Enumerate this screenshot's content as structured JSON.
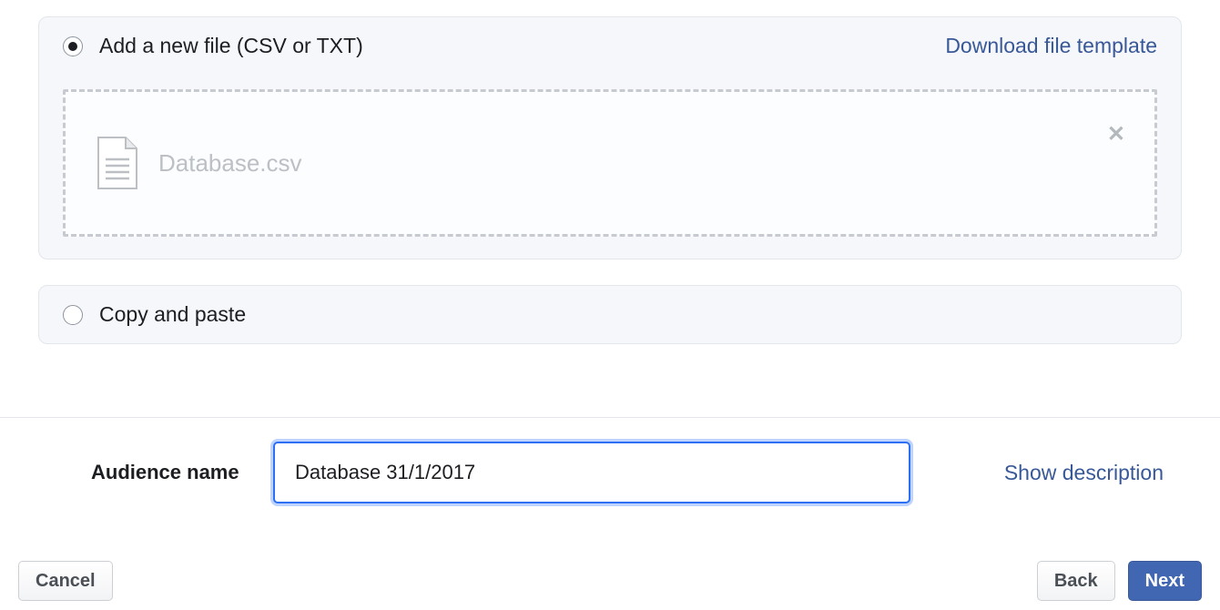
{
  "upload_panel": {
    "radio_label": "Add a new file (CSV or TXT)",
    "download_template": "Download file template",
    "file_name": "Database.csv"
  },
  "paste_panel": {
    "radio_label": "Copy and paste"
  },
  "form": {
    "audience_name_label": "Audience name",
    "audience_name_value": "Database 31/1/2017",
    "show_description": "Show description"
  },
  "footer": {
    "cancel": "Cancel",
    "back": "Back",
    "next": "Next"
  }
}
